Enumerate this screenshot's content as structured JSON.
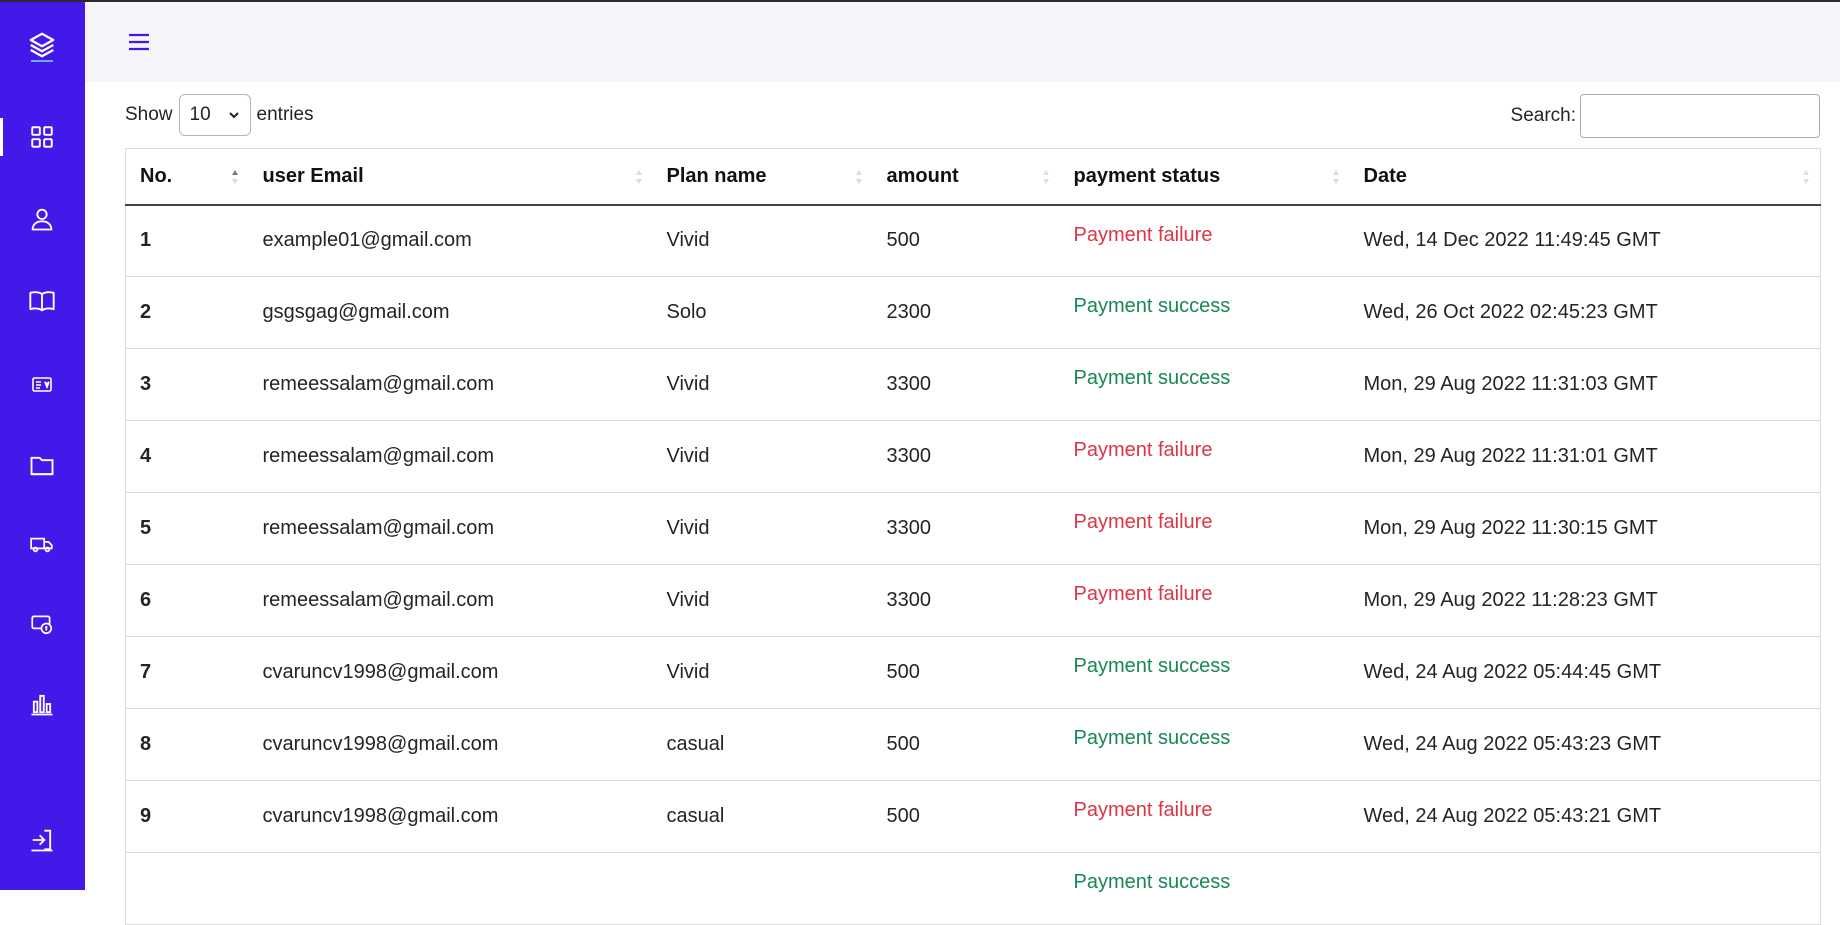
{
  "header": {
    "show_label": "Show",
    "entries_value": "10",
    "entries_label": "entries",
    "search_label": "Search:",
    "search_value": ""
  },
  "sidebar": {
    "items": [
      {
        "name": "dashboard",
        "icon": "grid-icon",
        "active": true
      },
      {
        "name": "users",
        "icon": "user-icon"
      },
      {
        "name": "books",
        "icon": "book-icon"
      },
      {
        "name": "cards",
        "icon": "card-icon"
      },
      {
        "name": "folders",
        "icon": "folder-icon"
      },
      {
        "name": "delivery",
        "icon": "truck-icon"
      },
      {
        "name": "payments",
        "icon": "money-icon"
      },
      {
        "name": "reports",
        "icon": "bar-chart-icon"
      }
    ],
    "logout_icon": "logout-icon"
  },
  "colors": {
    "sidebar_bg": "#4318e8",
    "topbar_bg": "#f5f5fa",
    "failure": "#dc3545",
    "success": "#198754"
  },
  "table": {
    "columns": [
      "No.",
      "user Email",
      "Plan name",
      "amount",
      "payment status",
      "Date"
    ],
    "rows": [
      {
        "no": "1",
        "email": "example01@gmail.com",
        "plan": "Vivid",
        "amount": "500",
        "status": "Payment failure",
        "date": "Wed, 14 Dec 2022 11:49:45 GMT"
      },
      {
        "no": "2",
        "email": "gsgsgag@gmail.com",
        "plan": "Solo",
        "amount": "2300",
        "status": "Payment success",
        "date": "Wed, 26 Oct 2022 02:45:23 GMT"
      },
      {
        "no": "3",
        "email": "remeessalam@gmail.com",
        "plan": "Vivid",
        "amount": "3300",
        "status": "Payment success",
        "date": "Mon, 29 Aug 2022 11:31:03 GMT"
      },
      {
        "no": "4",
        "email": "remeessalam@gmail.com",
        "plan": "Vivid",
        "amount": "3300",
        "status": "Payment failure",
        "date": "Mon, 29 Aug 2022 11:31:01 GMT"
      },
      {
        "no": "5",
        "email": "remeessalam@gmail.com",
        "plan": "Vivid",
        "amount": "3300",
        "status": "Payment failure",
        "date": "Mon, 29 Aug 2022 11:30:15 GMT"
      },
      {
        "no": "6",
        "email": "remeessalam@gmail.com",
        "plan": "Vivid",
        "amount": "3300",
        "status": "Payment failure",
        "date": "Mon, 29 Aug 2022 11:28:23 GMT"
      },
      {
        "no": "7",
        "email": "cvaruncv1998@gmail.com",
        "plan": "Vivid",
        "amount": "500",
        "status": "Payment success",
        "date": "Wed, 24 Aug 2022 05:44:45 GMT"
      },
      {
        "no": "8",
        "email": "cvaruncv1998@gmail.com",
        "plan": "casual",
        "amount": "500",
        "status": "Payment success",
        "date": "Wed, 24 Aug 2022 05:43:23 GMT"
      },
      {
        "no": "9",
        "email": "cvaruncv1998@gmail.com",
        "plan": "casual",
        "amount": "500",
        "status": "Payment failure",
        "date": "Wed, 24 Aug 2022 05:43:21 GMT"
      },
      {
        "no": "",
        "email": "",
        "plan": "",
        "amount": "",
        "status": "Payment success",
        "date": ""
      }
    ]
  }
}
